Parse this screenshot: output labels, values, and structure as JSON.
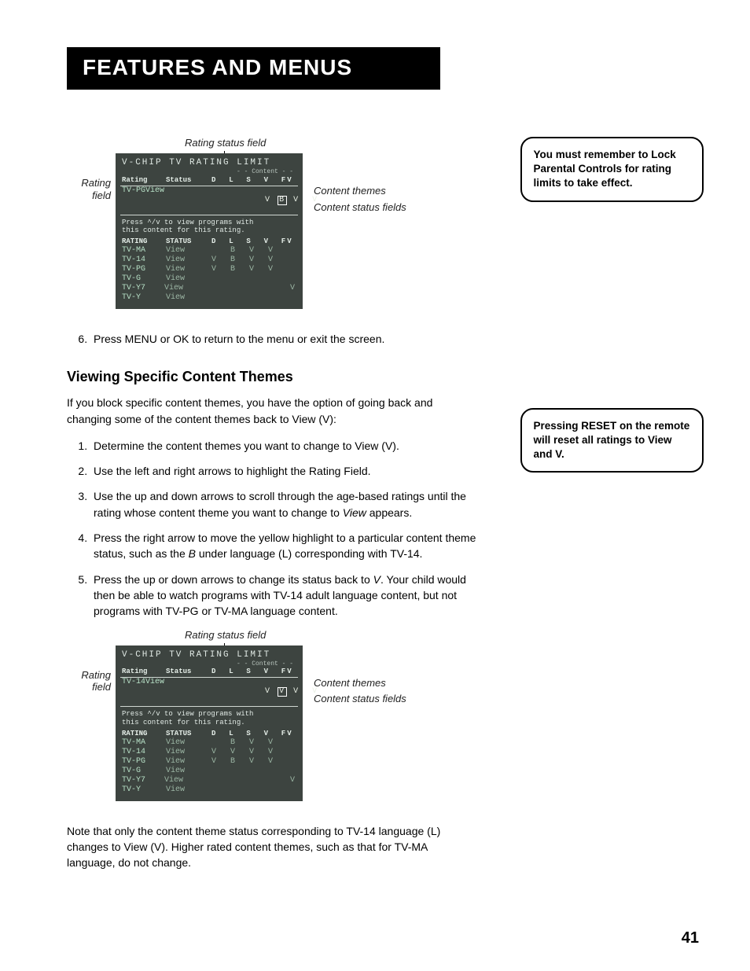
{
  "page_title": "Features and Menus",
  "page_number": "41",
  "figure_labels": {
    "rating_status_field": "Rating status field",
    "rating_field": "Rating\nfield",
    "content_themes": "Content themes",
    "content_status_fields": "Content status fields"
  },
  "screen1": {
    "title": "V-CHIP TV RATING LIMIT",
    "subhead": "- - Content - -",
    "header_rating": "Rating",
    "header_status": "Status",
    "header_flags": "D  L  S  V  FV",
    "active_rating": "TV-PG",
    "active_status": "View",
    "active_flags_pre": "V ",
    "active_flags_hl": "B",
    "active_flags_post": " V  V",
    "msg1": "Press ^/v to view programs with",
    "msg2": "this content for this rating.",
    "table_header_rating": "RATING",
    "table_header_status": "STATUS",
    "table_header_flags": "D  L  S  V  FV",
    "rows": [
      {
        "rating": "TV-MA",
        "status": "View",
        "flags": "   B  V  V"
      },
      {
        "rating": "TV-14",
        "status": "View",
        "flags": "V  B  V  V"
      },
      {
        "rating": "TV-PG",
        "status": "View",
        "flags": "V  B  V  V"
      },
      {
        "rating": "TV-G",
        "status": "View",
        "flags": ""
      },
      {
        "rating": "TV-Y7",
        "status": "View",
        "flags": "             V"
      },
      {
        "rating": "TV-Y",
        "status": "View",
        "flags": ""
      }
    ]
  },
  "screen2": {
    "title": "V-CHIP TV RATING LIMIT",
    "subhead": "- - Content - -",
    "header_rating": "Rating",
    "header_status": "Status",
    "header_flags": "D  L  S  V  FV",
    "active_rating": "TV-14",
    "active_status": "View",
    "active_flags_pre": "V ",
    "active_flags_hl": "V",
    "active_flags_post": " V  V",
    "msg1": "Press ^/v to view programs with",
    "msg2": "this content for this rating.",
    "table_header_rating": "RATING",
    "table_header_status": "STATUS",
    "table_header_flags": "D  L  S  V  FV",
    "rows": [
      {
        "rating": "TV-MA",
        "status": "View",
        "flags": "   B  V  V"
      },
      {
        "rating": "TV-14",
        "status": "View",
        "flags": "V  V  V  V"
      },
      {
        "rating": "TV-PG",
        "status": "View",
        "flags": "V  B  V  V"
      },
      {
        "rating": "TV-G",
        "status": "View",
        "flags": ""
      },
      {
        "rating": "TV-Y7",
        "status": "View",
        "flags": "             V"
      },
      {
        "rating": "TV-Y",
        "status": "View",
        "flags": ""
      }
    ]
  },
  "step6": "Press MENU or OK to return to the menu or exit the screen.",
  "section_heading": "Viewing Specific Content Themes",
  "intro_para": "If you block specific content themes, you have the option of going back and changing some of the content themes back to View (V):",
  "steps": {
    "s1": "Determine the content themes you want to change to View (V).",
    "s2": "Use the left and right arrows to highlight the Rating Field.",
    "s3_a": "Use the up and down arrows to scroll through the age-based ratings until the rating whose content theme you want to change to ",
    "s3_i": "View",
    "s3_b": " appears.",
    "s4_a": "Press the right arrow to move the yellow highlight to a particular content theme status, such as the ",
    "s4_i": "B",
    "s4_b": " under language (L) corresponding with TV-14.",
    "s5_a": "Press the up or down arrows to change its status back to ",
    "s5_i": "V",
    "s5_b": ".  Your child would then be able to watch programs with TV-14 adult language content, but not programs with  TV-PG or TV-MA language content."
  },
  "closing_para": "Note that only the content theme status corresponding to TV-14 language (L) changes to View (V). Higher rated content themes, such as that for TV-MA language, do not change.",
  "sidebar_note1": "You must remember to Lock Parental Controls for rating limits to take effect.",
  "sidebar_note2": "Pressing RESET on the remote will reset all ratings to View and V."
}
